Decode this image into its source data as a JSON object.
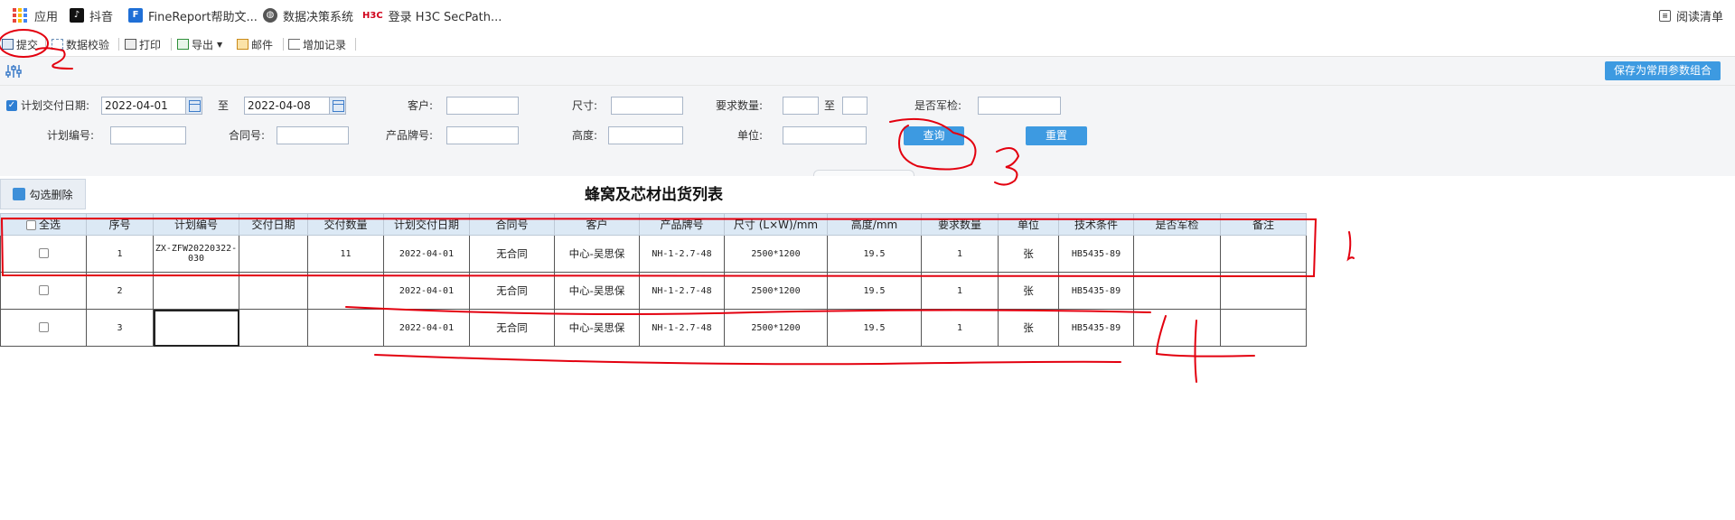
{
  "bookmarks": {
    "apps": "应用",
    "douyin": "抖音",
    "finereport": "FineReport帮助文...",
    "decision": "数据决策系统",
    "h3c_badge": "H3C",
    "h3c": "登录 H3C SecPath...",
    "reading_list": "阅读清单"
  },
  "toolbar": {
    "submit": "提交",
    "validate": "数据校验",
    "print": "打印",
    "export": "导出",
    "mail": "邮件",
    "add_record": "增加记录"
  },
  "params": {
    "save_combo": "保存为常用参数组合",
    "plan_date_label": "计划交付日期:",
    "plan_date_from": "2022-04-01",
    "to1": "至",
    "plan_date_to": "2022-04-08",
    "customer_label": "客户:",
    "size_label": "尺寸:",
    "req_qty_label": "要求数量:",
    "to2": "至",
    "military_label": "是否军检:",
    "plan_no_label": "计划编号:",
    "contract_label": "合同号:",
    "product_label": "产品牌号:",
    "height_label": "高度:",
    "unit_label": "单位:",
    "query_btn": "查询",
    "reset_btn": "重置"
  },
  "report": {
    "delete_checked": "勾选删除",
    "title": "蜂窝及芯材出货列表",
    "headers": [
      "全选",
      "序号",
      "计划编号",
      "交付日期",
      "交付数量",
      "计划交付日期",
      "合同号",
      "客户",
      "产品牌号",
      "尺寸 (L×W)/mm",
      "高度/mm",
      "要求数量",
      "单位",
      "技术条件",
      "是否军检",
      "备注"
    ],
    "rows": [
      [
        "",
        "1",
        "ZX-ZFW20220322-030",
        "",
        "11",
        "2022-04-01",
        "无合同",
        "中心-吴思保",
        "NH-1-2.7-48",
        "2500*1200",
        "19.5",
        "1",
        "张",
        "HB5435-89",
        "",
        ""
      ],
      [
        "",
        "2",
        "",
        "",
        "",
        "2022-04-01",
        "无合同",
        "中心-吴思保",
        "NH-1-2.7-48",
        "2500*1200",
        "19.5",
        "1",
        "张",
        "HB5435-89",
        "",
        ""
      ],
      [
        "",
        "3",
        "",
        "",
        "",
        "2022-04-01",
        "无合同",
        "中心-吴思保",
        "NH-1-2.7-48",
        "2500*1200",
        "19.5",
        "1",
        "张",
        "HB5435-89",
        "",
        ""
      ]
    ]
  },
  "colors": {
    "accent": "#3d9ae1",
    "header_bg": "#dce9f5",
    "annotation": "#e3000f"
  }
}
